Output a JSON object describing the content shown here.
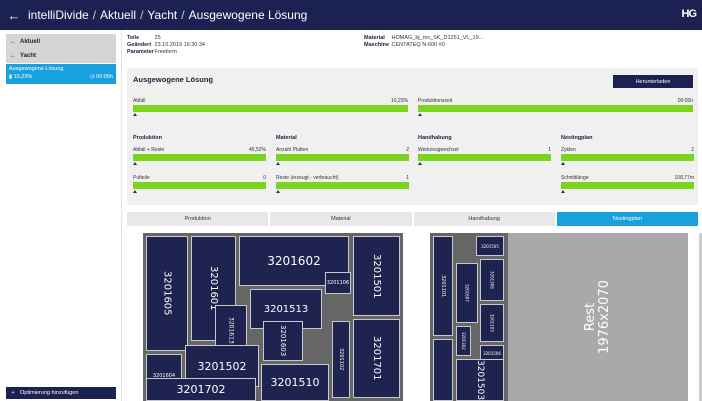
{
  "header": {
    "back_icon": "arrow-left-icon",
    "crumbs": [
      "intelliDivide",
      "Aktuell",
      "Yacht",
      "Ausgewogene Lösung"
    ],
    "separator": "/",
    "logo": "HG"
  },
  "sidebar": {
    "items": [
      {
        "label": "Aktuell",
        "icon": "arrow-left-icon"
      },
      {
        "label": "Yacht",
        "icon": "arrow-left-icon"
      }
    ],
    "active": {
      "label": "Ausgewogene Lösung",
      "waste": "10,23%",
      "time": "00:05h"
    },
    "add_button": {
      "icon": "plus-icon",
      "label": "Optimierung hinzufügen"
    }
  },
  "info_left": [
    {
      "label": "Teile",
      "value": "25"
    },
    {
      "label": "Geändert",
      "value": "23.10.2019 16:30:34"
    },
    {
      "label": "Parameter",
      "value": "Freeform"
    }
  ],
  "info_right": [
    {
      "label": "Material",
      "value": "HOMAG_bj_mx_SK_D1251_VL_19..."
    },
    {
      "label": "Maschine",
      "value": "CENTATEQ N-600 #0"
    }
  ],
  "panel": {
    "title": "Ausgewogene Lösung",
    "download_label": "Herunterladen",
    "top_metrics": [
      {
        "label": "Abfall",
        "value": "10,23%",
        "fill": 1.0
      },
      {
        "label": "Produktionszeit",
        "value": "00:05h",
        "fill": 1.0
      }
    ],
    "groups": [
      {
        "title": "Produktion",
        "metrics": [
          {
            "label": "Abfall + Reste",
            "value": "45,52%",
            "fill": 1.0
          },
          {
            "label": "Pufteile",
            "value": "0",
            "fill": 1.0
          }
        ]
      },
      {
        "title": "Material",
        "metrics": [
          {
            "label": "Anzahl Platten",
            "value": "2",
            "fill": 1.0
          },
          {
            "label": "Reste (erzeugt - verbraucht)",
            "value": "1",
            "fill": 1.0
          }
        ]
      },
      {
        "title": "Handhabung",
        "metrics": [
          {
            "label": "Werkzeugwechsel",
            "value": "1",
            "fill": 1.0
          }
        ]
      },
      {
        "title": "Nestingplan",
        "metrics": [
          {
            "label": "Zyklen",
            "value": "2",
            "fill": 1.0
          },
          {
            "label": "Schnittlänge",
            "value": "108,77m",
            "fill": 1.0
          }
        ]
      }
    ]
  },
  "tabs": [
    {
      "label": "Produktion",
      "active": false
    },
    {
      "label": "Material",
      "active": false
    },
    {
      "label": "Handhabung",
      "active": false
    },
    {
      "label": "Nestingplan",
      "active": true
    }
  ],
  "nesting": {
    "sheet1_parts": [
      "3201605",
      "3201601",
      "3201602",
      "3201501",
      "3201513",
      "3201106",
      "3201613",
      "3201603",
      "3201604",
      "3201502",
      "3201102",
      "3201701",
      "3201702",
      "3201510"
    ],
    "sheet2_parts": [
      "3201505",
      "3201101",
      "3201607",
      "3201306",
      "3201302",
      "3201103",
      "3201506",
      "3201503"
    ],
    "rest_label": "Rest",
    "rest_size": "1976x2070"
  },
  "colors": {
    "accent": "#19a1dd",
    "dark": "#1b2150",
    "bar": "#7ed321"
  }
}
